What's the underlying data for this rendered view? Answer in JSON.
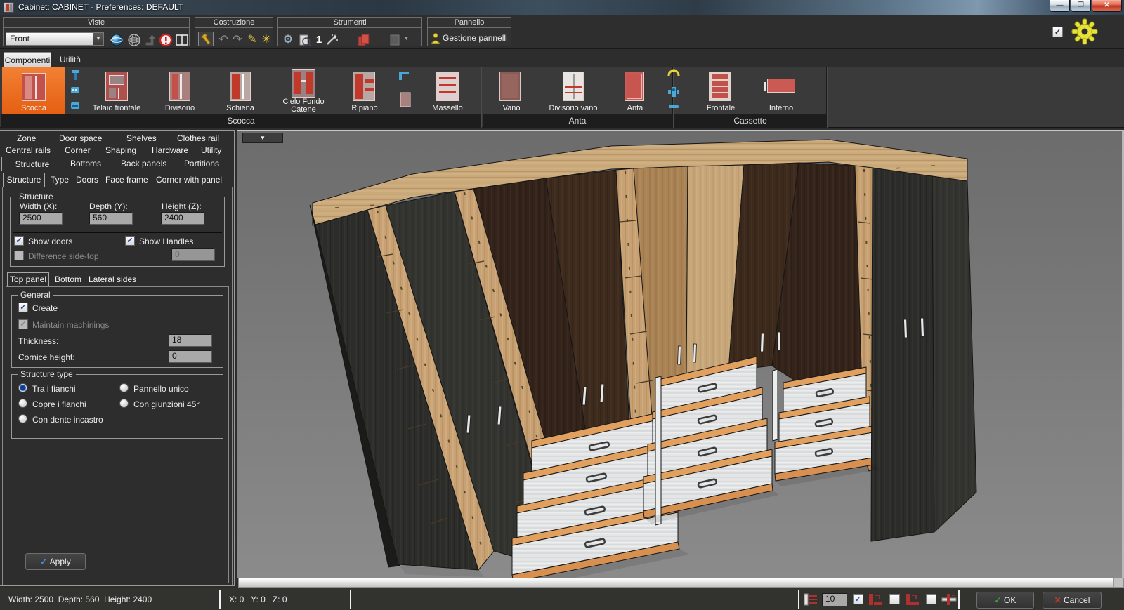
{
  "window": {
    "title": "Cabinet: CABINET - Preferences: DEFAULT"
  },
  "icons": {
    "dropdown_arrow": "▼",
    "undo": "↶",
    "redo": "↷",
    "pencil": "✎",
    "star": "✳",
    "gears": "⚙",
    "one": "1",
    "check": "✓",
    "cross": "✕",
    "minimize": "─",
    "restore": "❐"
  },
  "toolbar": {
    "viste": {
      "label": "Viste",
      "dropdown_value": "Front"
    },
    "costruzione": {
      "label": "Costruzione"
    },
    "strumenti": {
      "label": "Strumenti",
      "count_value": "1"
    },
    "pannello": {
      "label": "Pannello",
      "button_label": "Gestione pannelli"
    }
  },
  "ribbon": {
    "tabs": [
      {
        "label": "Componenti"
      },
      {
        "label": "Utilità"
      }
    ],
    "groups": [
      {
        "label": "Scocca",
        "items": [
          {
            "label": "Scocca"
          },
          {
            "label": "Telaio frontale"
          },
          {
            "label": "Divisorio"
          },
          {
            "label": "Schiena"
          },
          {
            "label": "Cielo Fondo Catene"
          },
          {
            "label": "Ripiano"
          },
          {
            "label": "Massello"
          }
        ]
      },
      {
        "label": "Anta",
        "items": [
          {
            "label": "Vano"
          },
          {
            "label": "Divisorio vano"
          },
          {
            "label": "Anta"
          }
        ]
      },
      {
        "label": "Cassetto",
        "items": [
          {
            "label": "Frontale"
          },
          {
            "label": "Interno"
          }
        ]
      }
    ]
  },
  "sidebar": {
    "tab_rows": [
      [
        "Zone",
        "Door space",
        "Shelves",
        "Clothes rail"
      ],
      [
        "Central rails",
        "Corner",
        "Shaping",
        "Hardware",
        "Utility"
      ],
      [
        "Structure",
        "Bottoms",
        "Back panels",
        "Partitions"
      ]
    ],
    "subtabs": [
      "Structure",
      "Type",
      "Doors",
      "Face frame",
      "Corner with panel"
    ],
    "structure_group": {
      "label": "Structure",
      "width_label": "Width (X):",
      "width_value": "2500",
      "depth_label": "Depth (Y):",
      "depth_value": "560",
      "height_label": "Height (Z):",
      "height_value": "2400",
      "show_doors": "Show doors",
      "show_handles": "Show Handles",
      "difference": "Difference side-top",
      "difference_value": "0"
    },
    "panel_tabs": [
      "Top panel",
      "Bottom",
      "Lateral sides"
    ],
    "general_group": {
      "label": "General",
      "create": "Create",
      "maintain": "Maintain machinings",
      "thickness_label": "Thickness:",
      "thickness_value": "18",
      "cornice_label": "Cornice height:",
      "cornice_value": "0"
    },
    "structure_type_group": {
      "label": "Structure type",
      "options": [
        "Tra i fianchi",
        "Pannello unico",
        "Copre i fianchi",
        "Con giunzioni 45°",
        "Con dente incastro"
      ]
    },
    "apply_label": "Apply"
  },
  "statusbar": {
    "dimensions": "Width: 2500  Depth: 560  Height: 2400",
    "coordinates": "X: 0   Y: 0   Z: 0",
    "spacing_value": "10",
    "ok_label": "OK",
    "cancel_label": "Cancel"
  }
}
